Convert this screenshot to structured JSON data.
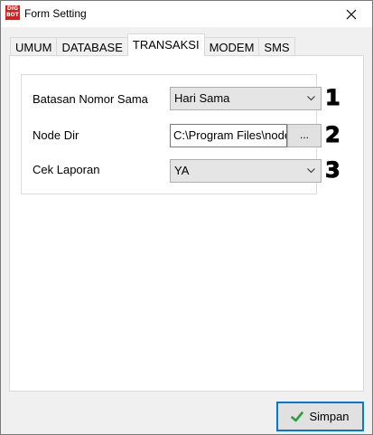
{
  "window": {
    "title": "Form Setting",
    "icon_text": [
      "DIG",
      "BOT"
    ]
  },
  "tabs": [
    {
      "label": "UMUM"
    },
    {
      "label": "DATABASE"
    },
    {
      "label": "TRANSAKSI",
      "active": true
    },
    {
      "label": "MODEM"
    },
    {
      "label": "SMS"
    }
  ],
  "form": {
    "batasan": {
      "label": "Batasan Nomor Sama",
      "value": "Hari Sama",
      "marker": "1"
    },
    "node_dir": {
      "label": "Node Dir",
      "value": "C:\\Program Files\\nodejs",
      "browse_label": "...",
      "marker": "2"
    },
    "cek_laporan": {
      "label": "Cek Laporan",
      "value": "YA",
      "marker": "3"
    }
  },
  "footer": {
    "save_label": "Simpan"
  },
  "colors": {
    "accent": "#0078d7",
    "check": "#2e9e3e",
    "icon_red": "#d32020"
  }
}
